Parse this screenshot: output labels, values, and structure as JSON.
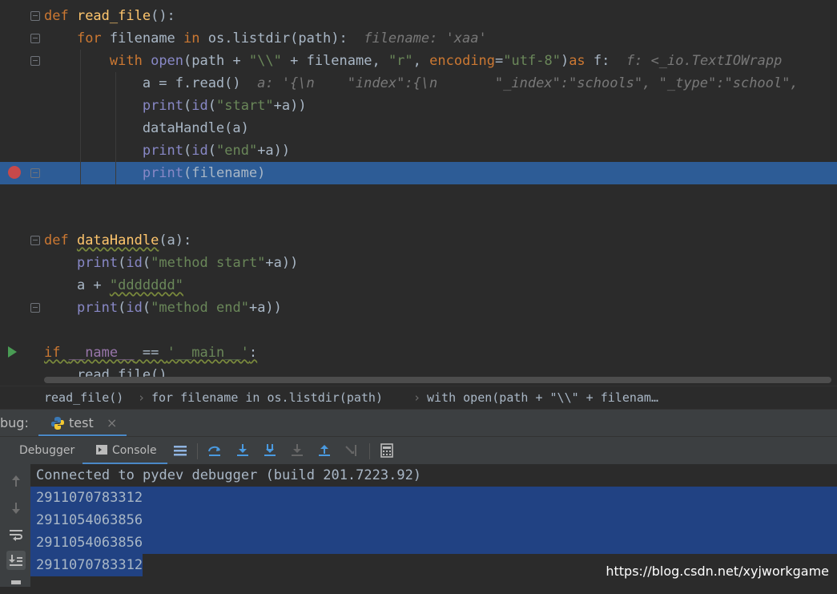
{
  "editor": {
    "lines": [
      [
        {
          "t": "def ",
          "c": "kw"
        },
        {
          "t": "read_file",
          "c": "fn"
        },
        {
          "t": "():"
        }
      ],
      [
        {
          "t": "    "
        },
        {
          "t": "for ",
          "c": "kw"
        },
        {
          "t": "filename "
        },
        {
          "t": "in ",
          "c": "kw"
        },
        {
          "t": "os.listdir(path):  "
        },
        {
          "t": "filename: 'xaa'",
          "c": "hint"
        }
      ],
      [
        {
          "t": "        "
        },
        {
          "t": "with ",
          "c": "kw"
        },
        {
          "t": "open",
          "c": "bi"
        },
        {
          "t": "(path + "
        },
        {
          "t": "\"\\\\\"",
          "c": "str"
        },
        {
          "t": " + filename, "
        },
        {
          "t": "\"r\"",
          "c": "str"
        },
        {
          "t": ", "
        },
        {
          "t": "encoding",
          "c": "kw"
        },
        {
          "t": "="
        },
        {
          "t": "\"utf-8\"",
          "c": "str"
        },
        {
          "t": ")"
        },
        {
          "t": "as ",
          "c": "kw"
        },
        {
          "t": "f:  "
        },
        {
          "t": "f: <_io.TextIOWrapp",
          "c": "hint"
        }
      ],
      [
        {
          "t": "            a = f.read()  "
        },
        {
          "t": "a: '{\\n    \"index\":{\\n       \"_index\":\"schools\", \"_type\":\"school\",",
          "c": "hint"
        }
      ],
      [
        {
          "t": "            "
        },
        {
          "t": "print",
          "c": "bi"
        },
        {
          "t": "("
        },
        {
          "t": "id",
          "c": "bi"
        },
        {
          "t": "("
        },
        {
          "t": "\"start\"",
          "c": "str"
        },
        {
          "t": "+a))"
        }
      ],
      [
        {
          "t": "            dataHandle(a)"
        }
      ],
      [
        {
          "t": "            "
        },
        {
          "t": "print",
          "c": "bi"
        },
        {
          "t": "("
        },
        {
          "t": "id",
          "c": "bi"
        },
        {
          "t": "("
        },
        {
          "t": "\"end\"",
          "c": "str"
        },
        {
          "t": "+a))"
        }
      ],
      [
        {
          "t": "            "
        },
        {
          "t": "print",
          "c": "bi"
        },
        {
          "t": "(filename)"
        }
      ],
      [],
      [],
      [
        {
          "t": "def ",
          "c": "kw"
        },
        {
          "t": "dataHandle",
          "c": "fn wavy"
        },
        {
          "t": "(a):"
        }
      ],
      [
        {
          "t": "    "
        },
        {
          "t": "print",
          "c": "bi"
        },
        {
          "t": "("
        },
        {
          "t": "id",
          "c": "bi"
        },
        {
          "t": "("
        },
        {
          "t": "\"method start\"",
          "c": "str"
        },
        {
          "t": "+a))"
        }
      ],
      [
        {
          "t": "    a + "
        },
        {
          "t": "\"ddddddd\"",
          "c": "str wavy"
        }
      ],
      [
        {
          "t": "    "
        },
        {
          "t": "print",
          "c": "bi"
        },
        {
          "t": "("
        },
        {
          "t": "id",
          "c": "bi"
        },
        {
          "t": "("
        },
        {
          "t": "\"method end\"",
          "c": "str"
        },
        {
          "t": "+a))"
        }
      ],
      [],
      [
        {
          "t": "if ",
          "c": "kw wavy"
        },
        {
          "t": "__name__",
          "c": "mg wavy"
        },
        {
          "t": " == ",
          "c": "wavy"
        },
        {
          "t": "'__main__'",
          "c": "str wavy"
        },
        {
          "t": ":",
          "c": "wavy"
        }
      ],
      [
        {
          "t": "    read_file()"
        }
      ]
    ]
  },
  "breadcrumb": [
    "read_file()",
    "for filename in os.listdir(path)",
    "with open(path + \"\\\\\" + filenam…"
  ],
  "debug": {
    "title": "bug:",
    "run_tab": "test",
    "tabs": {
      "debugger": "Debugger",
      "console": "Console"
    }
  },
  "console": {
    "lines": [
      "Connected to pydev debugger (build 201.7223.92)",
      "2911070783312",
      "2911054063856",
      "2911054063856",
      "2911070783312"
    ]
  },
  "watermark": "https://blog.csdn.net/xyjworkgame"
}
